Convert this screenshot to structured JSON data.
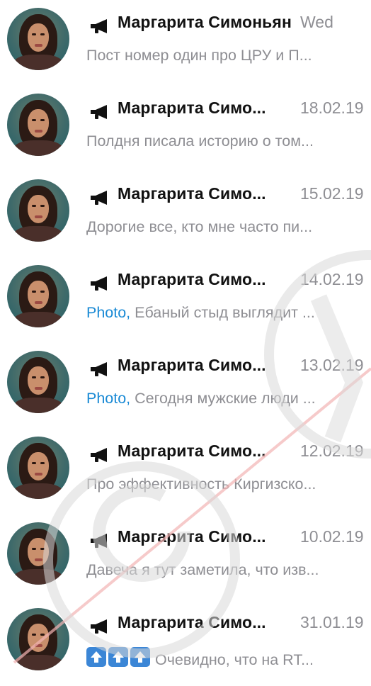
{
  "chats": [
    {
      "sender": "Маргарита Симоньян",
      "date": "Wed",
      "media": "",
      "preview": "Пост номер один про ЦРУ и П...",
      "has_arrows": false
    },
    {
      "sender": "Маргарита Симо...",
      "date": "18.02.19",
      "media": "",
      "preview": "Полдня писала историю о том...",
      "has_arrows": false
    },
    {
      "sender": "Маргарита Симо...",
      "date": "15.02.19",
      "media": "",
      "preview": "Дорогие все, кто мне часто пи...",
      "has_arrows": false
    },
    {
      "sender": "Маргарита Симо...",
      "date": "14.02.19",
      "media": "Photo,",
      "preview": " Ебаный стыд выглядит ...",
      "has_arrows": false
    },
    {
      "sender": "Маргарита Симо...",
      "date": "13.02.19",
      "media": "Photo,",
      "preview": " Сегодня мужские люди ...",
      "has_arrows": false
    },
    {
      "sender": "Маргарита Симо...",
      "date": "12.02.19",
      "media": "",
      "preview": "Про эффективность Киргизско...",
      "has_arrows": false
    },
    {
      "sender": "Маргарита Симо...",
      "date": "10.02.19",
      "media": "",
      "preview": "Давеча я тут заметила, что изв...",
      "has_arrows": false
    },
    {
      "sender": "Маргарита Симо...",
      "date": "31.01.19",
      "media": "",
      "preview": "Очевидно, что на RT...",
      "has_arrows": true
    }
  ],
  "icons": {
    "channel": "megaphone-icon",
    "emoji": "up-arrow-emoji-icon"
  },
  "colors": {
    "sender_text": "#111111",
    "secondary_text": "#8e8e93",
    "media_link": "#1a8ad5",
    "arrow_emoji": "#3b86d6",
    "watermark": "#d9d9d9"
  }
}
